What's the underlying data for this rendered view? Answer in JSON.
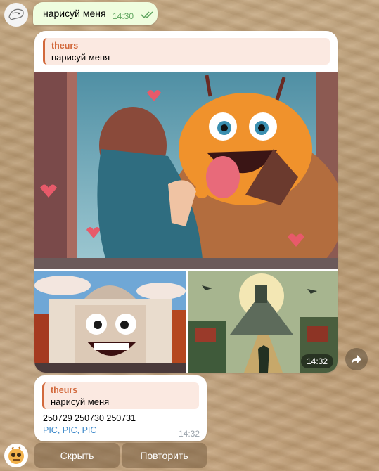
{
  "outgoing": {
    "text": "нарисуй меня",
    "time": "14:30",
    "status_icon": "double-check-icon"
  },
  "album": {
    "reply": {
      "name": "theurs",
      "text": "нарисуй меня"
    },
    "images": [
      "image-girl-and-monster",
      "image-white-house-face",
      "image-city-creature"
    ],
    "time": "14:32"
  },
  "links_message": {
    "reply": {
      "name": "theurs",
      "text": "нарисуй меня"
    },
    "ids": "250729 250730 250731",
    "links": [
      "PIC",
      "PIC",
      "PIC"
    ],
    "time": "14:32"
  },
  "keyboard": {
    "hide_label": "Скрыть",
    "repeat_label": "Повторить"
  },
  "colors": {
    "accent": "#d2693c",
    "link": "#3a87c9",
    "outgoing_bg": "#effdde"
  }
}
